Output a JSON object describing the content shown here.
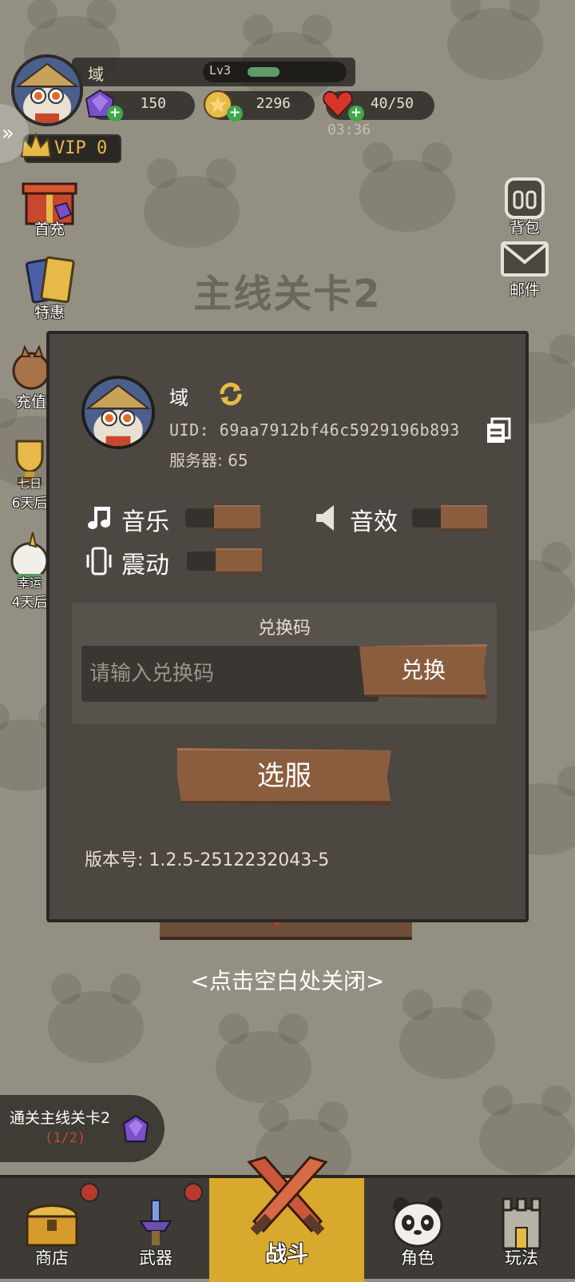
{
  "player": {
    "name": "域",
    "level": "Lv3",
    "level_progress": 0.25,
    "vip": "VIP 0"
  },
  "resources": {
    "gems": "150",
    "gold": "2296",
    "stamina": "40/50",
    "stamina_timer": "03:36"
  },
  "left_menu": [
    {
      "label": "首充",
      "icon": "gift-box-icon"
    },
    {
      "label": "特惠",
      "icon": "card-pack-icon"
    },
    {
      "label": "充值",
      "icon": "recharge-icon"
    },
    {
      "label": "七日",
      "sub": "6天后",
      "icon": "trophy-icon"
    },
    {
      "label": "幸运",
      "sub": "4天后",
      "icon": "unicorn-icon"
    }
  ],
  "right_menu": {
    "bag": "背包",
    "mail": "邮件"
  },
  "stage_title": "主线关卡2",
  "settings_panel": {
    "name": "域",
    "uid": "UID: 69aa7912bf46c5929196b893",
    "server": "服务器: 65",
    "music_label": "音乐",
    "sfx_label": "音效",
    "vibration_label": "震动",
    "music_level": 0.5,
    "sfx_level": 0.5,
    "vibration_level": 0.5,
    "redeem_title": "兑换码",
    "redeem_placeholder": "请输入兑换码",
    "redeem_button": "兑换",
    "select_server_button": "选服",
    "version": "版本号: 1.2.5-2512232043-5"
  },
  "under_plank_value": "5",
  "close_hint": "<点击空白处关闭>",
  "quest": {
    "title": "通关主线关卡2",
    "progress": "(1/2)"
  },
  "nav": {
    "shop": "商店",
    "weapon": "武器",
    "battle": "战斗",
    "character": "角色",
    "gameplay": "玩法"
  },
  "colors": {
    "background": "#948f83",
    "panel": "#4c4741",
    "wood_button": "#8b5d3f",
    "nav_active": "#d8a92c",
    "accent_gold": "#e7b949"
  }
}
